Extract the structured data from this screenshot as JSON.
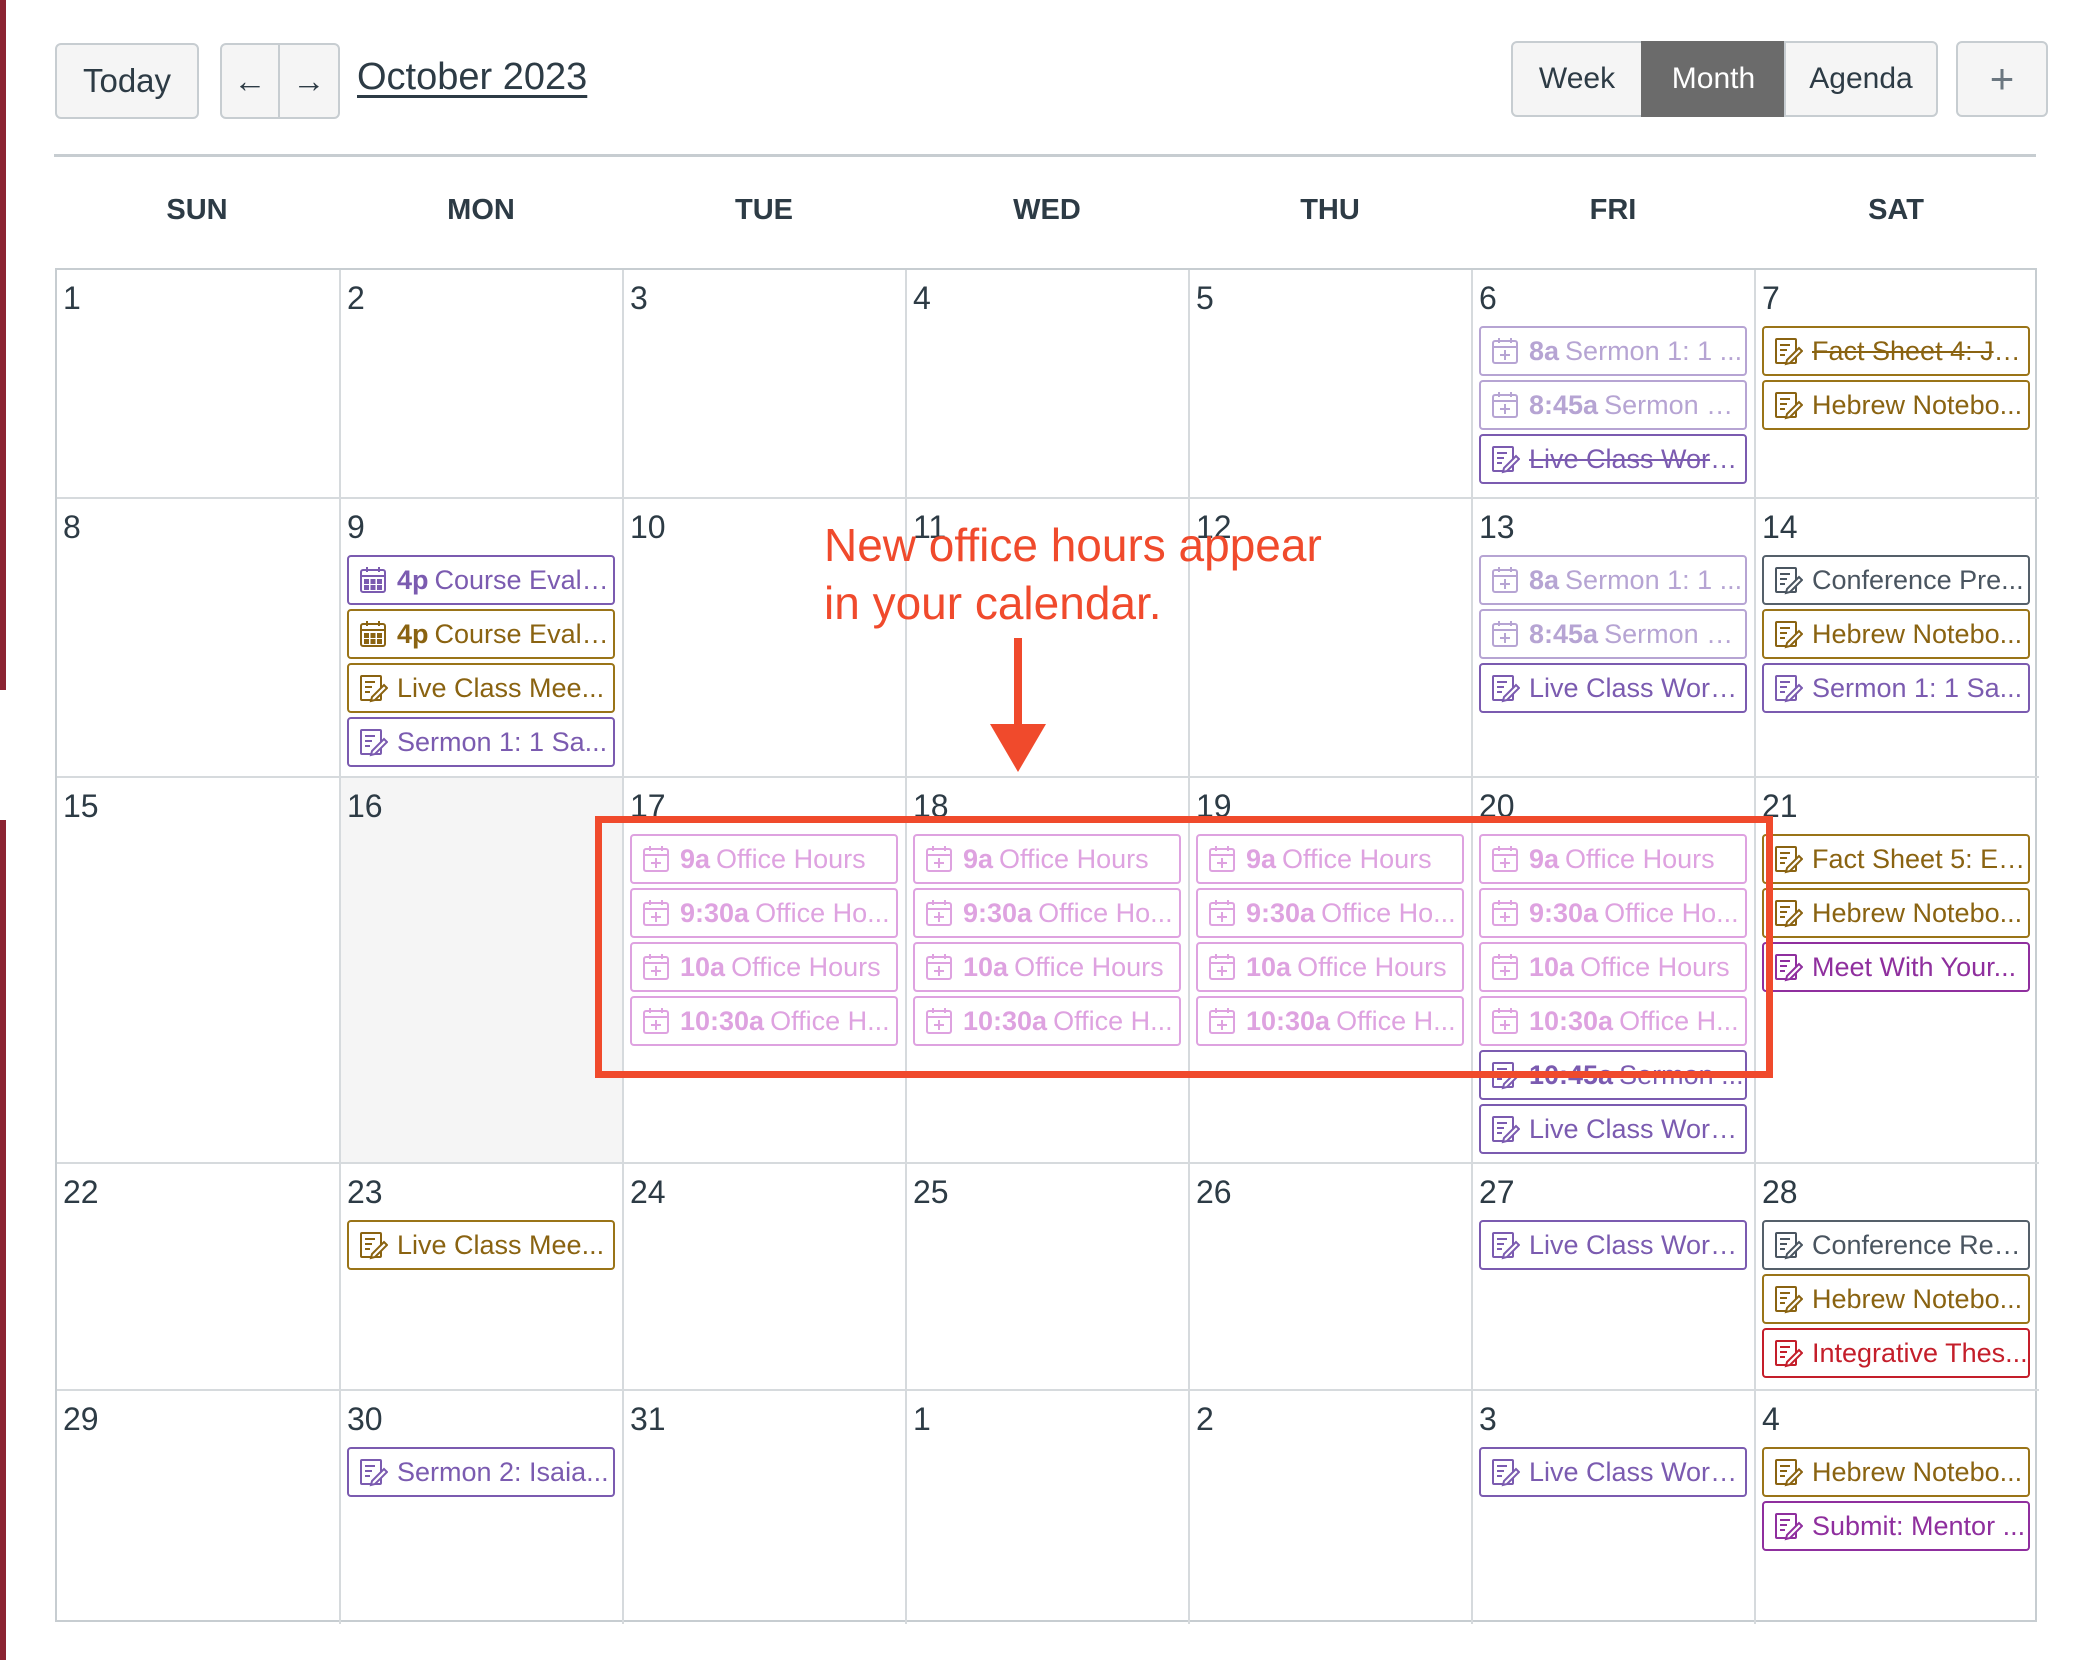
{
  "toolbar": {
    "today_label": "Today",
    "prev_arrow": "←",
    "next_arrow": "→",
    "month_title": "October 2023",
    "views": [
      "Week",
      "Month",
      "Agenda"
    ],
    "active_view": "Month",
    "add_label": "+"
  },
  "weekdays": [
    "SUN",
    "MON",
    "TUE",
    "WED",
    "THU",
    "FRI",
    "SAT"
  ],
  "weeks": [
    {
      "days": [
        {
          "num": "1"
        },
        {
          "num": "2"
        },
        {
          "num": "3"
        },
        {
          "num": "4"
        },
        {
          "num": "5"
        },
        {
          "num": "6",
          "events": [
            {
              "time": "8a",
              "title": "Sermon 1: 1 ...",
              "color": "purple",
              "icon": "calendar-plus-icon",
              "faded": true
            },
            {
              "time": "8:45a",
              "title": "Sermon 1:...",
              "color": "purple",
              "icon": "calendar-plus-icon",
              "faded": true
            },
            {
              "title": "Live Class Work...",
              "color": "purple",
              "icon": "assignment-icon",
              "strike": true
            }
          ]
        },
        {
          "num": "7",
          "events": [
            {
              "title": "Fact Sheet 4: Je...",
              "color": "gold",
              "icon": "assignment-icon",
              "strike": true
            },
            {
              "title": "Hebrew Notebo...",
              "color": "gold",
              "icon": "assignment-icon"
            }
          ]
        }
      ]
    },
    {
      "days": [
        {
          "num": "8"
        },
        {
          "num": "9",
          "events": [
            {
              "time": "4p",
              "title": "Course Evalu...",
              "color": "purple",
              "icon": "calendar-grid-icon"
            },
            {
              "time": "4p",
              "title": "Course Evalu...",
              "color": "gold",
              "icon": "calendar-grid-icon"
            },
            {
              "title": "Live Class Mee...",
              "color": "gold",
              "icon": "assignment-icon"
            },
            {
              "title": "Sermon 1: 1 Sa...",
              "color": "purple",
              "icon": "assignment-icon"
            }
          ]
        },
        {
          "num": "10"
        },
        {
          "num": "11"
        },
        {
          "num": "12"
        },
        {
          "num": "13",
          "events": [
            {
              "time": "8a",
              "title": "Sermon 1: 1 ...",
              "color": "purple",
              "icon": "calendar-plus-icon",
              "faded": true
            },
            {
              "time": "8:45a",
              "title": "Sermon 1:...",
              "color": "purple",
              "icon": "calendar-plus-icon",
              "faded": true
            },
            {
              "title": "Live Class Work...",
              "color": "purple",
              "icon": "assignment-icon"
            }
          ]
        },
        {
          "num": "14",
          "events": [
            {
              "title": "Conference Pre...",
              "color": "gray",
              "icon": "assignment-icon"
            },
            {
              "title": "Hebrew Notebo...",
              "color": "gold",
              "icon": "assignment-icon"
            },
            {
              "title": "Sermon 1: 1 Sa...",
              "color": "purple",
              "icon": "assignment-icon"
            }
          ]
        }
      ]
    },
    {
      "days": [
        {
          "num": "15"
        },
        {
          "num": "16",
          "shaded": true
        },
        {
          "num": "17",
          "events": [
            {
              "time": "9a",
              "title": "Office Hours",
              "color": "pink",
              "icon": "calendar-plus-icon",
              "faded": true
            },
            {
              "time": "9:30a",
              "title": "Office Ho...",
              "color": "pink",
              "icon": "calendar-plus-icon",
              "faded": true
            },
            {
              "time": "10a",
              "title": "Office Hours",
              "color": "pink",
              "icon": "calendar-plus-icon",
              "faded": true
            },
            {
              "time": "10:30a",
              "title": "Office H...",
              "color": "pink",
              "icon": "calendar-plus-icon",
              "faded": true
            }
          ]
        },
        {
          "num": "18",
          "events": [
            {
              "time": "9a",
              "title": "Office Hours",
              "color": "pink",
              "icon": "calendar-plus-icon",
              "faded": true
            },
            {
              "time": "9:30a",
              "title": "Office Ho...",
              "color": "pink",
              "icon": "calendar-plus-icon",
              "faded": true
            },
            {
              "time": "10a",
              "title": "Office Hours",
              "color": "pink",
              "icon": "calendar-plus-icon",
              "faded": true
            },
            {
              "time": "10:30a",
              "title": "Office H...",
              "color": "pink",
              "icon": "calendar-plus-icon",
              "faded": true
            }
          ]
        },
        {
          "num": "19",
          "events": [
            {
              "time": "9a",
              "title": "Office Hours",
              "color": "pink",
              "icon": "calendar-plus-icon",
              "faded": true
            },
            {
              "time": "9:30a",
              "title": "Office Ho...",
              "color": "pink",
              "icon": "calendar-plus-icon",
              "faded": true
            },
            {
              "time": "10a",
              "title": "Office Hours",
              "color": "pink",
              "icon": "calendar-plus-icon",
              "faded": true
            },
            {
              "time": "10:30a",
              "title": "Office H...",
              "color": "pink",
              "icon": "calendar-plus-icon",
              "faded": true
            }
          ]
        },
        {
          "num": "20",
          "events": [
            {
              "time": "9a",
              "title": "Office Hours",
              "color": "pink",
              "icon": "calendar-plus-icon",
              "faded": true
            },
            {
              "time": "9:30a",
              "title": "Office Ho...",
              "color": "pink",
              "icon": "calendar-plus-icon",
              "faded": true
            },
            {
              "time": "10a",
              "title": "Office Hours",
              "color": "pink",
              "icon": "calendar-plus-icon",
              "faded": true
            },
            {
              "time": "10:30a",
              "title": "Office H...",
              "color": "pink",
              "icon": "calendar-plus-icon",
              "faded": true
            },
            {
              "time": "10:45a",
              "title": "Sermon ...",
              "color": "purple",
              "icon": "assignment-icon"
            },
            {
              "title": "Live Class Work...",
              "color": "purple",
              "icon": "assignment-icon"
            }
          ]
        },
        {
          "num": "21",
          "events": [
            {
              "title": "Fact Sheet 5: Ez...",
              "color": "gold",
              "icon": "assignment-icon"
            },
            {
              "title": "Hebrew Notebo...",
              "color": "gold",
              "icon": "assignment-icon"
            },
            {
              "title": "Meet With Your...",
              "color": "magenta",
              "icon": "assignment-icon"
            }
          ]
        }
      ]
    },
    {
      "days": [
        {
          "num": "22"
        },
        {
          "num": "23",
          "events": [
            {
              "title": "Live Class Mee...",
              "color": "gold",
              "icon": "assignment-icon"
            }
          ]
        },
        {
          "num": "24"
        },
        {
          "num": "25"
        },
        {
          "num": "26"
        },
        {
          "num": "27",
          "events": [
            {
              "title": "Live Class Work...",
              "color": "purple",
              "icon": "assignment-icon"
            }
          ]
        },
        {
          "num": "28",
          "events": [
            {
              "title": "Conference Refl...",
              "color": "gray",
              "icon": "assignment-icon"
            },
            {
              "title": "Hebrew Notebo...",
              "color": "gold",
              "icon": "assignment-icon"
            },
            {
              "title": "Integrative Thes...",
              "color": "red",
              "icon": "assignment-icon"
            }
          ]
        }
      ]
    },
    {
      "days": [
        {
          "num": "29"
        },
        {
          "num": "30",
          "events": [
            {
              "title": "Sermon 2: Isaia...",
              "color": "purple",
              "icon": "assignment-icon"
            }
          ]
        },
        {
          "num": "31"
        },
        {
          "num": "1"
        },
        {
          "num": "2"
        },
        {
          "num": "3",
          "events": [
            {
              "title": "Live Class Work...",
              "color": "purple",
              "icon": "assignment-icon"
            }
          ]
        },
        {
          "num": "4",
          "events": [
            {
              "title": "Hebrew Notebo...",
              "color": "gold",
              "icon": "assignment-icon"
            },
            {
              "title": "Submit: Mentor ...",
              "color": "magenta",
              "icon": "assignment-icon"
            }
          ]
        }
      ]
    }
  ],
  "annotation": {
    "text_line1": "New office hours appear",
    "text_line2": "in your calendar.",
    "color": "#f04a2c"
  },
  "colors": {
    "purple": "#7b5bb0",
    "gold": "#9a7418",
    "gray": "#55606a",
    "red": "#c41e2a",
    "magenta": "#8f2f9e",
    "pink": "#c457c8",
    "active_view_bg": "#6b6b6b"
  }
}
